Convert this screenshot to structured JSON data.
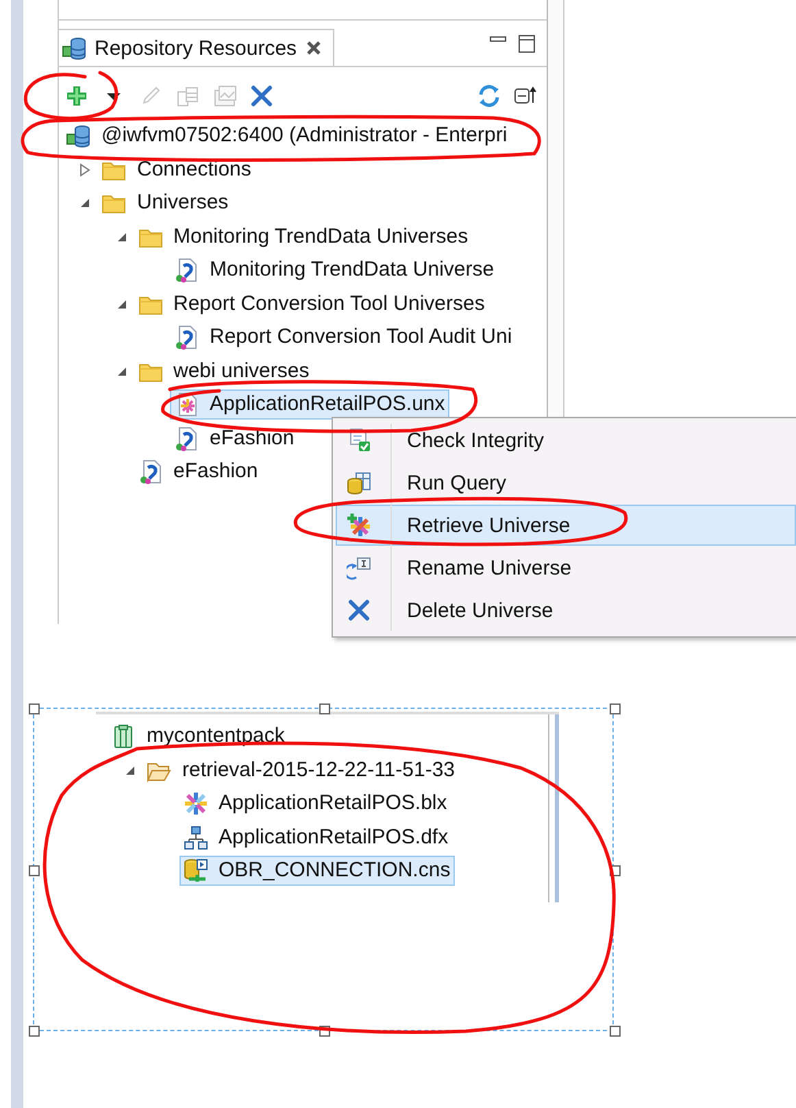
{
  "panel": {
    "title": "Repository Resources",
    "toolbar": [
      {
        "kind": "add",
        "disabled": false
      },
      {
        "kind": "dropdown",
        "disabled": false
      },
      {
        "kind": "edit",
        "disabled": true
      },
      {
        "kind": "copy",
        "disabled": true
      },
      {
        "kind": "publish",
        "disabled": true
      },
      {
        "kind": "delete",
        "disabled": false
      },
      {
        "kind": "refresh",
        "disabled": false
      },
      {
        "kind": "collapse",
        "disabled": false
      }
    ],
    "tree": [
      {
        "label": "@iwfvm07502:6400 (Administrator - Enterpri",
        "kind": "server",
        "selected": false,
        "children": [
          {
            "label": "Connections",
            "kind": "folder",
            "expanded": false,
            "selected": false
          },
          {
            "label": "Universes",
            "kind": "folder",
            "expanded": true,
            "selected": false,
            "children": [
              {
                "label": "Monitoring TrendData Universes",
                "kind": "folder",
                "expanded": true,
                "selected": false,
                "children": [
                  {
                    "label": "Monitoring TrendData Universe",
                    "kind": "universe",
                    "selected": false
                  }
                ]
              },
              {
                "label": "Report Conversion Tool Universes",
                "kind": "folder",
                "expanded": true,
                "selected": false,
                "children": [
                  {
                    "label": "Report Conversion Tool Audit Uni",
                    "kind": "universe",
                    "selected": false
                  }
                ]
              },
              {
                "label": "webi universes",
                "kind": "folder",
                "expanded": true,
                "selected": false,
                "children": [
                  {
                    "label": "ApplicationRetailPOS.unx",
                    "kind": "unx",
                    "selected": true
                  },
                  {
                    "label": "eFashion",
                    "kind": "universe",
                    "selected": false
                  }
                ]
              },
              {
                "label": "eFashion",
                "kind": "universe",
                "selected": false
              }
            ]
          }
        ]
      }
    ]
  },
  "context_menu": {
    "items": [
      {
        "label": "Check Integrity",
        "kind": "check",
        "selected": false
      },
      {
        "label": "Run Query",
        "kind": "query",
        "selected": false
      },
      {
        "label": "Retrieve Universe",
        "kind": "retrieve",
        "selected": true
      },
      {
        "label": "Rename Universe",
        "kind": "rename",
        "selected": false
      },
      {
        "label": "Delete Universe",
        "kind": "delete",
        "selected": false
      }
    ]
  },
  "content_pack": {
    "tree": [
      {
        "label": "mycontentpack",
        "kind": "pack",
        "selected": false,
        "children": [
          {
            "label": "retrieval-2015-12-22-11-51-33",
            "kind": "open-folder",
            "expanded": true,
            "selected": false,
            "children": [
              {
                "label": "ApplicationRetailPOS.blx",
                "kind": "blx",
                "selected": false
              },
              {
                "label": "ApplicationRetailPOS.dfx",
                "kind": "dfx",
                "selected": false
              },
              {
                "label": "OBR_CONNECTION.cns",
                "kind": "cns",
                "selected": true
              }
            ]
          }
        ]
      }
    ]
  }
}
